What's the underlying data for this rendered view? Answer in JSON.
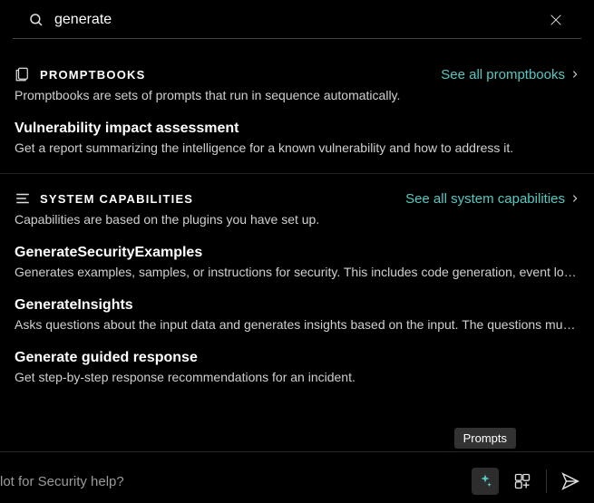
{
  "search": {
    "value": "generate"
  },
  "promptbooks": {
    "section_title": "PROMPTBOOKS",
    "see_all_label": "See all promptbooks",
    "description": "Promptbooks are sets of prompts that run in sequence automatically.",
    "items": [
      {
        "title": "Vulnerability impact assessment",
        "desc": "Get a report summarizing the intelligence for a known vulnerability and how to address it."
      }
    ]
  },
  "capabilities": {
    "section_title": "SYSTEM CAPABILITIES",
    "see_all_label": "See all system capabilities",
    "description": "Capabilities are based on the plugins you have set up.",
    "items": [
      {
        "title": "GenerateSecurityExamples",
        "desc": "Generates examples, samples, or instructions for security. This includes code generation, event logs, or reports. The response is limited to security topics."
      },
      {
        "title": "GenerateInsights",
        "desc": "Asks questions about the input data and generates insights based on the input. The questions must be related to the provided data."
      },
      {
        "title": "Generate guided response",
        "desc": "Get step-by-step response recommendations for an incident."
      }
    ]
  },
  "bottom": {
    "placeholder": "lot for Security help?",
    "tooltip": "Prompts"
  },
  "colors": {
    "accent": "#55c9c1"
  }
}
